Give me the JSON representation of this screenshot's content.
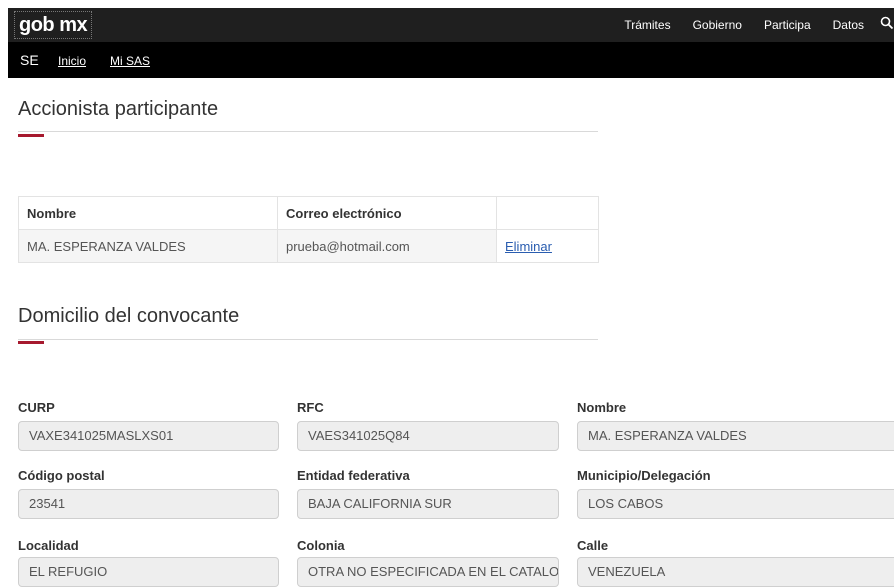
{
  "header": {
    "logo": "gob mx",
    "nav": [
      "Trámites",
      "Gobierno",
      "Participa",
      "Datos"
    ],
    "search_icon": "search-icon"
  },
  "subnav": {
    "section": "SE",
    "links": [
      "Inicio",
      "Mi SAS"
    ]
  },
  "accionista": {
    "title": "Accionista participante",
    "columns": [
      "Nombre",
      "Correo electrónico",
      ""
    ],
    "rows": [
      {
        "nombre": "MA. ESPERANZA VALDES",
        "correo": "prueba@hotmail.com",
        "accion": "Eliminar"
      }
    ]
  },
  "domicilio": {
    "title": "Domicilio del convocante",
    "fields": [
      {
        "label": "CURP",
        "value": "VAXE341025MASLXS01"
      },
      {
        "label": "RFC",
        "value": "VAES341025Q84"
      },
      {
        "label": "Nombre",
        "value": "MA. ESPERANZA VALDES"
      },
      {
        "label": "Código postal",
        "value": "23541"
      },
      {
        "label": "Entidad federativa",
        "value": "BAJA CALIFORNIA SUR"
      },
      {
        "label": "Municipio/Delegación",
        "value": "LOS CABOS"
      },
      {
        "label": "Localidad",
        "value": "EL REFUGIO"
      },
      {
        "label": "Colonia",
        "value": "OTRA NO ESPECIFICADA EN EL CATALOGO"
      },
      {
        "label": "Calle",
        "value": "VENEZUELA"
      }
    ]
  }
}
